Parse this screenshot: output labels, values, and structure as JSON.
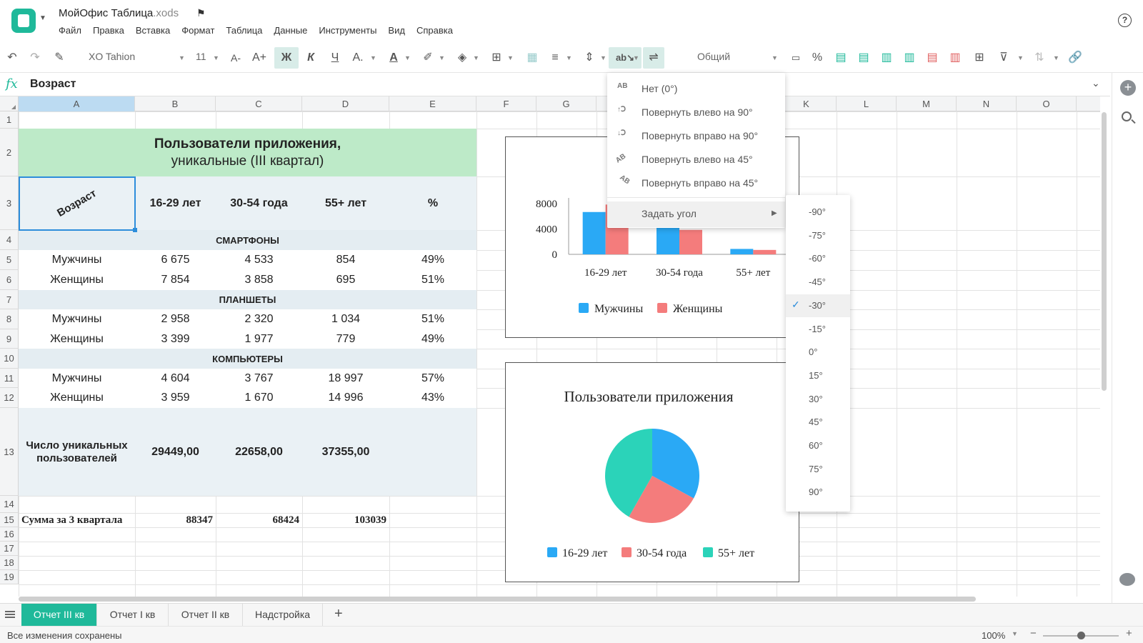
{
  "app": {
    "title": "МойОфис Таблица",
    "file_ext": ".xods"
  },
  "menubar": [
    "Файл",
    "Правка",
    "Вставка",
    "Формат",
    "Таблица",
    "Данные",
    "Инструменты",
    "Вид",
    "Справка"
  ],
  "toolbar": {
    "font_name": "XO Tahion",
    "font_size": "11",
    "bold_label": "Ж",
    "italic_label": "К",
    "underline_label": "Ч",
    "number_format": "Общий",
    "icons": [
      "undo-icon",
      "redo-icon",
      "format-painter-icon",
      "decrease-font-icon",
      "increase-font-icon",
      "bold-icon",
      "italic-icon",
      "underline-icon",
      "text-effects-icon",
      "text-color-icon",
      "highlight-icon",
      "fill-color-icon",
      "borders-icon",
      "grid-icon",
      "align-icon",
      "vertical-align-icon",
      "text-rotate-icon",
      "wrap-text-icon",
      "currency-format-icon",
      "percent-icon",
      "insert-table-icon",
      "filter-icon",
      "sort-icon",
      "link-icon"
    ]
  },
  "formula": {
    "value": "Возраст"
  },
  "columns": [
    "A",
    "B",
    "C",
    "D",
    "E",
    "F",
    "G",
    "H",
    "I",
    "J",
    "K",
    "L",
    "M",
    "N",
    "O"
  ],
  "rows": [
    "1",
    "2",
    "3",
    "4",
    "5",
    "6",
    "7",
    "8",
    "9",
    "10",
    "11",
    "12",
    "13",
    "14",
    "15",
    "16",
    "17",
    "18",
    "19"
  ],
  "sheet": {
    "title_line1": "Пользователи приложения,",
    "title_line2": "уникальные (III квартал)",
    "header": [
      "Возраст",
      "16-29 лет",
      "30-54 года",
      "55+ лет",
      "%"
    ],
    "sections": [
      {
        "name": "СМАРТФОНЫ",
        "rows": [
          [
            "Мужчины",
            "6 675",
            "4 533",
            "854",
            "49%"
          ],
          [
            "Женщины",
            "7 854",
            "3 858",
            "695",
            "51%"
          ]
        ]
      },
      {
        "name": "ПЛАНШЕТЫ",
        "rows": [
          [
            "Мужчины",
            "2 958",
            "2 320",
            "1 034",
            "51%"
          ],
          [
            "Женщины",
            "3 399",
            "1 977",
            "779",
            "49%"
          ]
        ]
      },
      {
        "name": "КОМПЬЮТЕРЫ",
        "rows": [
          [
            "Мужчины",
            "4 604",
            "3 767",
            "18 997",
            "57%"
          ],
          [
            "Женщины",
            "3 959",
            "1 670",
            "14 996",
            "43%"
          ]
        ]
      }
    ],
    "unique_label": "Число уникальных пользователей",
    "unique": [
      "29449,00",
      "22658,00",
      "37355,00"
    ],
    "sum_label": "Сумма за 3 квартала",
    "sum": [
      "88347",
      "68424",
      "103039"
    ]
  },
  "chart_data": [
    {
      "type": "bar",
      "title": "",
      "categories": [
        "16-29 лет",
        "30-54 года",
        "55+ лет"
      ],
      "series": [
        {
          "name": "Мужчины",
          "values": [
            6675,
            4533,
            854
          ],
          "color": "#2aa9f5"
        },
        {
          "name": "Женщины",
          "values": [
            7854,
            3858,
            695
          ],
          "color": "#f47c7c"
        }
      ],
      "ylim": [
        0,
        8000
      ],
      "yticks": [
        "8000",
        "4000",
        "0"
      ],
      "legend": "bottom"
    },
    {
      "type": "pie",
      "title": "Пользователи приложения",
      "slices": [
        {
          "name": "16-29 лет",
          "value": 29449,
          "color": "#2aa9f5"
        },
        {
          "name": "30-54 года",
          "value": 22658,
          "color": "#f47c7c"
        },
        {
          "name": "55+ лет",
          "value": 37355,
          "color": "#2bd3b9"
        }
      ],
      "legend": "bottom"
    }
  ],
  "rotate_menu": {
    "items": [
      {
        "label": "Нет (0°)",
        "icon": "no-rotation-icon"
      },
      {
        "label": "Повернуть влево на 90°",
        "icon": "rotate-left-90-icon"
      },
      {
        "label": "Повернуть вправо на 90°",
        "icon": "rotate-right-90-icon"
      },
      {
        "label": "Повернуть влево на 45°",
        "icon": "rotate-left-45-icon"
      },
      {
        "label": "Повернуть вправо на 45°",
        "icon": "rotate-right-45-icon"
      }
    ],
    "set_angle": "Задать угол"
  },
  "angle_menu": {
    "items": [
      "-90°",
      "-75°",
      "-60°",
      "-45°",
      "-30°",
      "-15°",
      "0°",
      "15°",
      "30°",
      "45°",
      "60°",
      "75°",
      "90°"
    ],
    "selected": "-30°"
  },
  "tabs": [
    {
      "label": "Отчет III кв",
      "active": true
    },
    {
      "label": "Отчет I кв",
      "active": false
    },
    {
      "label": "Отчет II кв",
      "active": false
    },
    {
      "label": "Надстройка",
      "active": false
    }
  ],
  "status": {
    "text": "Все изменения сохранены",
    "zoom": "100%",
    "zoom_level": 0.5
  },
  "colors": {
    "accent": "#1fb99a",
    "title_fill": "#bdeac8",
    "header_fill": "#eaf1f5",
    "selection": "#2d8ddb"
  }
}
